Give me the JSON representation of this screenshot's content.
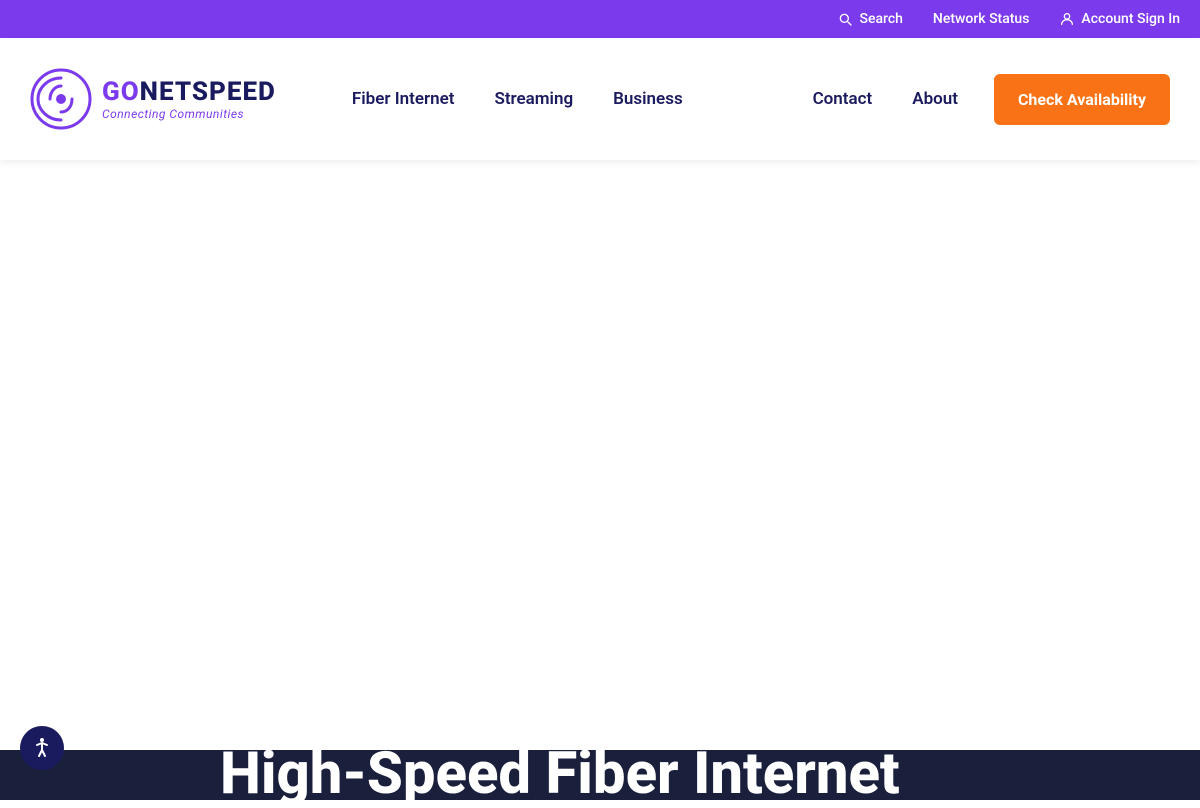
{
  "utility_bar": {
    "search_placeholder": "Search",
    "network_status_label": "Network Status",
    "account_sign_in_label": "Account Sign In"
  },
  "nav": {
    "logo_name_part1": "GO",
    "logo_name_part2": "NETSPEED",
    "logo_tagline": "Connecting Communities",
    "links": [
      {
        "label": "Fiber Internet",
        "id": "fiber-internet"
      },
      {
        "label": "Streaming",
        "id": "streaming"
      },
      {
        "label": "Business",
        "id": "business"
      },
      {
        "label": "Contact",
        "id": "contact"
      },
      {
        "label": "About",
        "id": "about"
      }
    ],
    "cta_label": "Check Availability"
  },
  "hero": {
    "title": "High-Speed Fiber Internet"
  },
  "colors": {
    "purple": "#7c3aed",
    "navy": "#1a1a5e",
    "orange": "#f97316",
    "dark_bg": "#1a1f3c"
  }
}
